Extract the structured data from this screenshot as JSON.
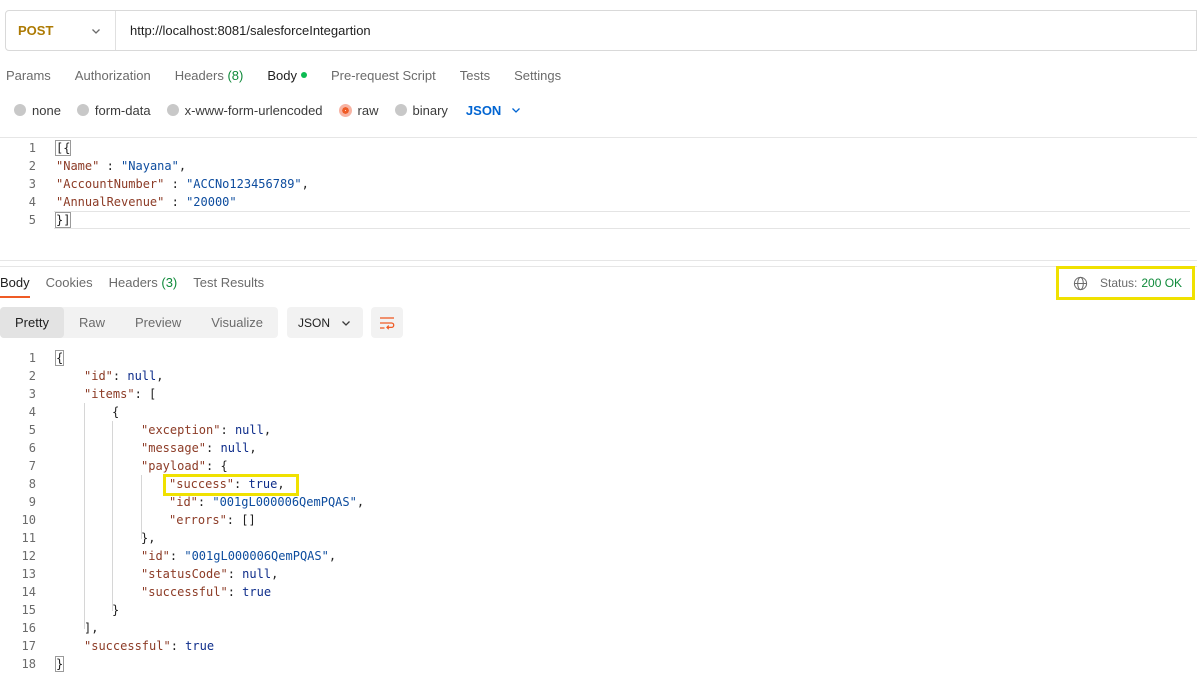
{
  "request": {
    "method": "POST",
    "url": "http://localhost:8081/salesforceIntegartion",
    "tabs": {
      "params": "Params",
      "authorization": "Authorization",
      "headers": "Headers",
      "headers_count": "(8)",
      "body": "Body",
      "pre_request": "Pre-request Script",
      "tests": "Tests",
      "settings": "Settings"
    },
    "body_types": {
      "none": "none",
      "form_data": "form-data",
      "urlencoded": "x-www-form-urlencoded",
      "raw": "raw",
      "binary": "binary",
      "selected": "raw"
    },
    "language": "JSON",
    "line_numbers": [
      "1",
      "2",
      "3",
      "4",
      "5"
    ],
    "body_lines": {
      "l1": "[{",
      "l2_key": "\"Name\"",
      "l2_sep": " : ",
      "l2_val": "\"Nayana\"",
      "l2_end": ",",
      "l3_key": "\"AccountNumber\"",
      "l3_sep": " : ",
      "l3_val": "\"ACCNo123456789\"",
      "l3_end": ",",
      "l4_key": "\"AnnualRevenue\"",
      "l4_sep": " : ",
      "l4_val": "\"20000\"",
      "l5": "}]"
    }
  },
  "response": {
    "tabs": {
      "body": "Body",
      "cookies": "Cookies",
      "headers": "Headers",
      "headers_count": "(3)",
      "test_results": "Test Results"
    },
    "status_label": "Status:",
    "status_value": "200 OK",
    "view_modes": {
      "pretty": "Pretty",
      "raw": "Raw",
      "preview": "Preview",
      "visualize": "Visualize"
    },
    "format": "JSON",
    "line_numbers": [
      "1",
      "2",
      "3",
      "4",
      "5",
      "6",
      "7",
      "8",
      "9",
      "10",
      "11",
      "12",
      "13",
      "14",
      "15",
      "16",
      "17",
      "18"
    ],
    "lines": {
      "l1": "{",
      "l2_key": "\"id\"",
      "l2_val": "null",
      "l3_key": "\"items\"",
      "l3_rest": ": [",
      "l4": "{",
      "l5_key": "\"exception\"",
      "l5_val": "null",
      "l6_key": "\"message\"",
      "l6_val": "null",
      "l7_key": "\"payload\"",
      "l7_rest": ": {",
      "l8_key": "\"success\"",
      "l8_val": "true",
      "l9_key": "\"id\"",
      "l9_val": "\"001gL000006QemPQAS\"",
      "l10_key": "\"errors\"",
      "l10_val": "[]",
      "l11": "},",
      "l12_key": "\"id\"",
      "l12_val": "\"001gL000006QemPQAS\"",
      "l13_key": "\"statusCode\"",
      "l13_val": "null",
      "l14_key": "\"successful\"",
      "l14_val": "true",
      "l15": "}",
      "l16": "],",
      "l17_key": "\"successful\"",
      "l17_val": "true",
      "l18": "}"
    }
  },
  "colors": {
    "accent": "#ef5b25",
    "method_post": "#ad7a03",
    "status_ok": "#0f8a3a",
    "highlight": "#f0e100",
    "json_key": "#8c3b26",
    "json_value": "#0d4c9e"
  },
  "icons": {
    "method_dropdown": "chevron-down-icon",
    "language_dropdown": "chevron-down-icon",
    "network": "globe-icon",
    "wrap": "text-wrap-icon"
  }
}
